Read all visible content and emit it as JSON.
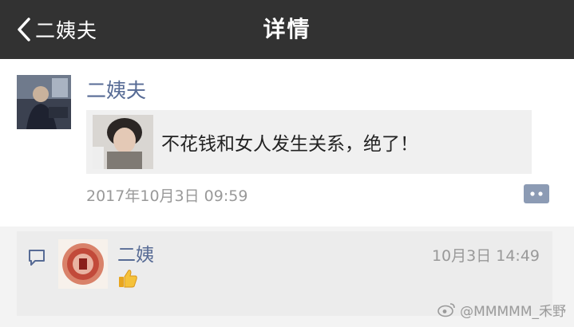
{
  "nav": {
    "back_label": "二姨夫",
    "title": "详情"
  },
  "post": {
    "author": "二姨夫",
    "link_text": "不花钱和女人发生关系，绝了！",
    "timestamp": "2017年10月3日 09:59"
  },
  "likes": {
    "name": "二姨",
    "time": "10月3日 14:49"
  },
  "watermark": "@MMMMM_禾野",
  "colors": {
    "nav_bg": "#323232",
    "name_link": "#576b95",
    "muted": "#999999",
    "like_bg": "#ececec"
  }
}
